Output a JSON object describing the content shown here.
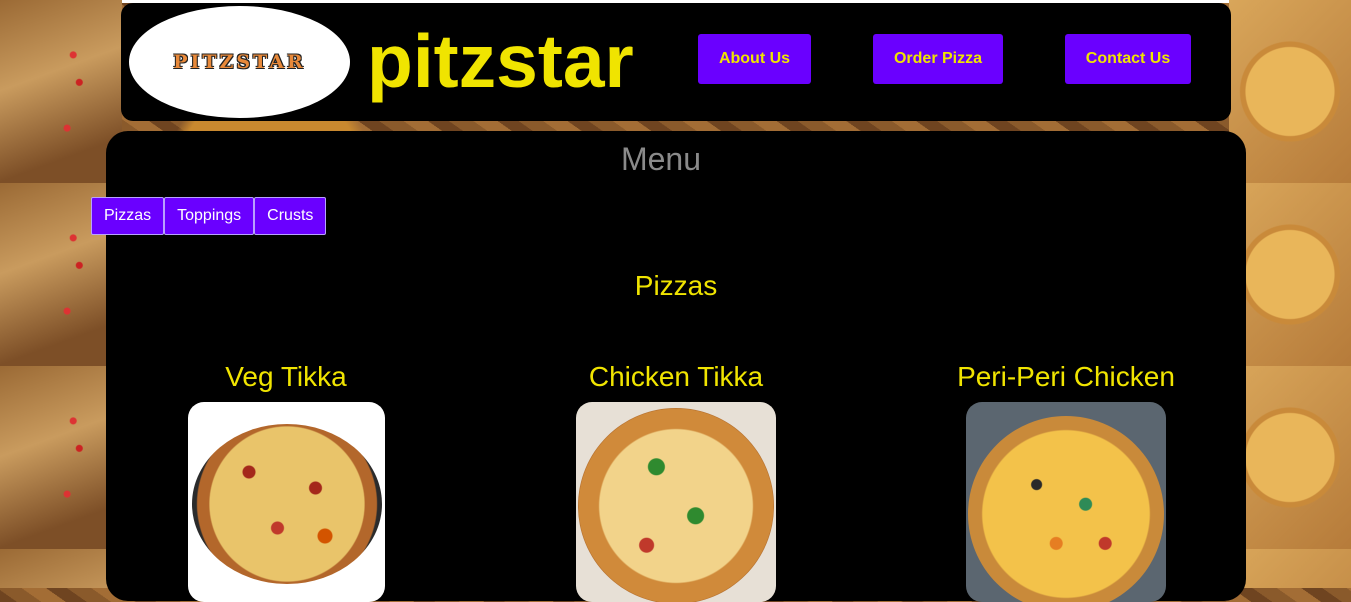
{
  "header": {
    "logo_text": "PITZSTAR",
    "site_title": "pitzstar",
    "nav": {
      "about": "About Us",
      "order": "Order Pizza",
      "contact": "Contact Us"
    }
  },
  "menu": {
    "title": "Menu",
    "tabs": [
      "Pizzas",
      "Toppings",
      "Crusts"
    ],
    "section_title": "Pizzas",
    "items": [
      {
        "name": "Veg Tikka"
      },
      {
        "name": "Chicken Tikka"
      },
      {
        "name": "Peri-Peri Chicken"
      }
    ]
  },
  "colors": {
    "accent": "#6a00ff",
    "title_yellow": "#f0e400",
    "panel": "#000000"
  }
}
